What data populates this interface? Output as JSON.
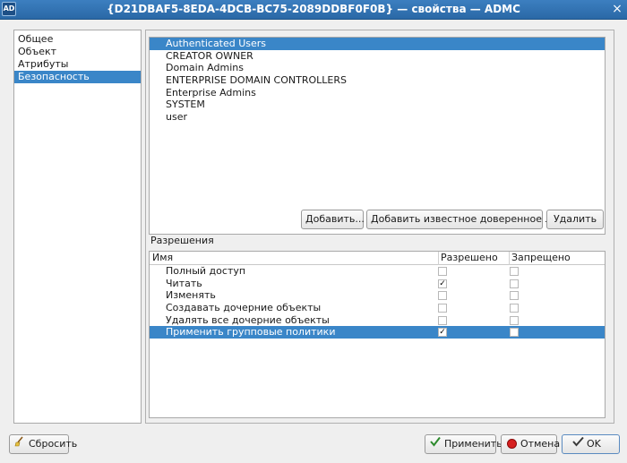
{
  "window": {
    "app_icon": "AD",
    "title": "{D21DBAF5-8EDA-4DCB-BC75-2089DDBF0F0B} — свойства — ADMC",
    "close_glyph": "×"
  },
  "nav": {
    "items": [
      {
        "label": "Общее"
      },
      {
        "label": "Объект"
      },
      {
        "label": "Атрибуты"
      },
      {
        "label": "Безопасность"
      }
    ],
    "selected": "Безопасность"
  },
  "trustees": {
    "items": [
      {
        "label": "Authenticated Users"
      },
      {
        "label": "CREATOR OWNER"
      },
      {
        "label": "Domain Admins"
      },
      {
        "label": "ENTERPRISE DOMAIN CONTROLLERS"
      },
      {
        "label": "Enterprise Admins"
      },
      {
        "label": "SYSTEM"
      },
      {
        "label": "user"
      }
    ],
    "selected": "Authenticated Users"
  },
  "trustee_buttons": {
    "add": "Добавить...",
    "add_well_known": "Добавить известное доверенное лицо...",
    "remove": "Удалить"
  },
  "permissions": {
    "label": "Разрешения",
    "columns": {
      "name": "Имя",
      "allowed": "Разрешено",
      "denied": "Запрещено"
    },
    "rows": [
      {
        "name": "Полный доступ",
        "allowed": false,
        "denied": false
      },
      {
        "name": "Читать",
        "allowed": true,
        "denied": false
      },
      {
        "name": "Изменять",
        "allowed": false,
        "denied": false
      },
      {
        "name": "Создавать дочерние объекты",
        "allowed": false,
        "denied": false
      },
      {
        "name": "Удалять все дочерние объекты",
        "allowed": false,
        "denied": false
      },
      {
        "name": "Применить групповые политики",
        "allowed": true,
        "denied": false
      }
    ],
    "selected": "Применить групповые политики",
    "check_glyph": "✓"
  },
  "footer": {
    "reset": "Сбросить",
    "apply": "Применить",
    "cancel": "Отмена",
    "ok": "OK"
  },
  "colors": {
    "selection": "#3a86c8",
    "titlebar": "#2f72b3"
  }
}
